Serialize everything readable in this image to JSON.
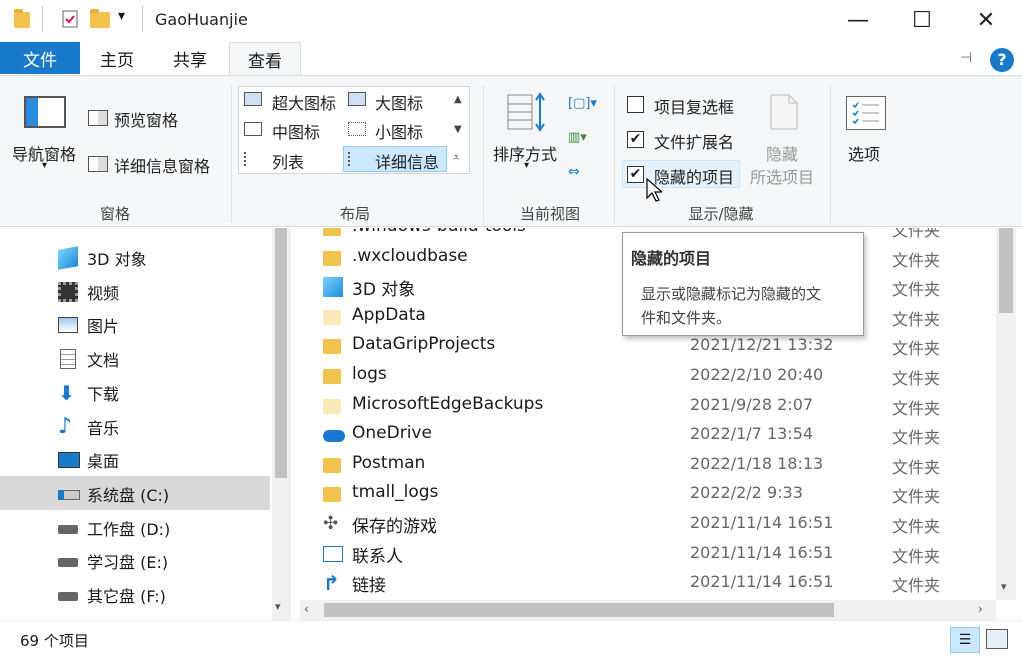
{
  "window": {
    "title": "GaoHuanjie",
    "minimize": "—",
    "maximize": "☐",
    "close": "✕"
  },
  "tabs": [
    {
      "label": "文件"
    },
    {
      "label": "主页"
    },
    {
      "label": "共享"
    },
    {
      "label": "查看"
    }
  ],
  "ribbon": {
    "pane": {
      "group_label": "窗格",
      "nav_pane": "导航窗格",
      "preview_pane": "预览窗格",
      "details_pane": "详细信息窗格"
    },
    "layout": {
      "group_label": "布局",
      "items": [
        "超大图标",
        "大图标",
        "中图标",
        "小图标",
        "列表",
        "详细信息"
      ]
    },
    "current_view": {
      "group_label": "当前视图",
      "sort_by": "排序方式"
    },
    "show_hide": {
      "group_label": "显示/隐藏",
      "item_checkboxes": "项目复选框",
      "file_extensions": "文件扩展名",
      "hidden_items": "隐藏的项目",
      "hide_selected_1": "隐藏",
      "hide_selected_2": "所选项目",
      "checked": {
        "item_checkboxes": false,
        "file_extensions": true,
        "hidden_items": true
      }
    },
    "options": "选项"
  },
  "tooltip": {
    "title": "隐藏的项目",
    "body_line1": "显示或隐藏标记为隐藏的文",
    "body_line2": "件和文件夹。"
  },
  "nav": [
    {
      "label": "3D 对象",
      "icon": "cube-icon"
    },
    {
      "label": "视频",
      "icon": "video-icon"
    },
    {
      "label": "图片",
      "icon": "picture-icon"
    },
    {
      "label": "文档",
      "icon": "document-icon"
    },
    {
      "label": "下载",
      "icon": "download-icon"
    },
    {
      "label": "音乐",
      "icon": "music-icon"
    },
    {
      "label": "桌面",
      "icon": "desktop-icon"
    },
    {
      "label": "系统盘 (C:)",
      "icon": "drive-c-icon",
      "selected": true
    },
    {
      "label": "工作盘 (D:)",
      "icon": "drive-icon"
    },
    {
      "label": "学习盘 (E:)",
      "icon": "drive-icon"
    },
    {
      "label": "其它盘 (F:)",
      "icon": "drive-icon"
    }
  ],
  "files": [
    {
      "name": ".windows-build-tools",
      "date": "",
      "type": "文件夹",
      "icon": "folder-icon"
    },
    {
      "name": ".wxcloudbase",
      "date": "",
      "type": "文件夹",
      "icon": "folder-icon"
    },
    {
      "name": "3D 对象",
      "date": "",
      "type": "文件夹",
      "icon": "cube-icon"
    },
    {
      "name": "AppData",
      "date": "",
      "type": "文件夹",
      "icon": "folder-faded-icon"
    },
    {
      "name": "DataGripProjects",
      "date": "2021/12/21 13:32",
      "type": "文件夹",
      "icon": "folder-icon"
    },
    {
      "name": "logs",
      "date": "2022/2/10 20:40",
      "type": "文件夹",
      "icon": "folder-icon"
    },
    {
      "name": "MicrosoftEdgeBackups",
      "date": "2021/9/28 2:07",
      "type": "文件夹",
      "icon": "folder-faded-icon"
    },
    {
      "name": "OneDrive",
      "date": "2022/1/7 13:54",
      "type": "文件夹",
      "icon": "cloud-icon"
    },
    {
      "name": "Postman",
      "date": "2022/1/18 18:13",
      "type": "文件夹",
      "icon": "folder-icon"
    },
    {
      "name": "tmall_logs",
      "date": "2022/2/2 9:33",
      "type": "文件夹",
      "icon": "folder-icon"
    },
    {
      "name": "保存的游戏",
      "date": "2021/11/14 16:51",
      "type": "文件夹",
      "icon": "game-icon"
    },
    {
      "name": "联系人",
      "date": "2021/11/14 16:51",
      "type": "文件夹",
      "icon": "contacts-icon"
    },
    {
      "name": "链接",
      "date": "2021/11/14 16:51",
      "type": "文件夹",
      "icon": "link-icon"
    }
  ],
  "status": {
    "count": "69 个项目"
  },
  "colors": {
    "accent": "#1979ca",
    "folder": "#f2c24f",
    "selected": "#cce8ff"
  }
}
